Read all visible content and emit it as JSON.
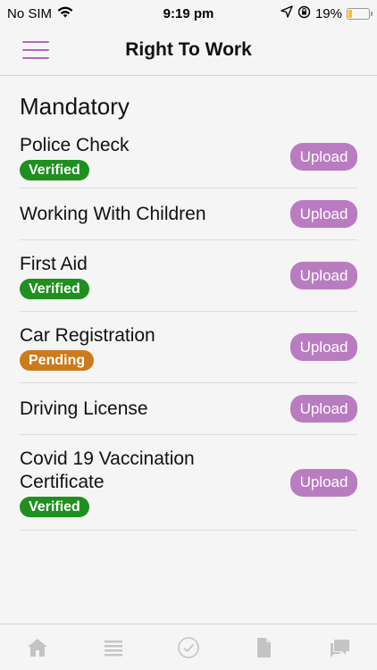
{
  "status_bar": {
    "carrier": "No SIM",
    "time": "9:19 pm",
    "battery": "19%",
    "battery_level": 0.19
  },
  "header": {
    "title": "Right To Work",
    "menu_icon": "hamburger-menu-icon"
  },
  "section": {
    "title": "Mandatory"
  },
  "documents": [
    {
      "name": "Police Check",
      "status": "Verified",
      "status_type": "verified",
      "button": "Upload"
    },
    {
      "name": "Working With Children",
      "status": "",
      "status_type": "",
      "button": "Upload"
    },
    {
      "name": "First Aid",
      "status": "Verified",
      "status_type": "verified",
      "button": "Upload"
    },
    {
      "name": "Car Registration",
      "status": "Pending",
      "status_type": "pending",
      "button": "Upload"
    },
    {
      "name": "Driving License",
      "status": "",
      "status_type": "",
      "button": "Upload"
    },
    {
      "name": "Covid 19 Vaccination Certificate",
      "status": "Verified",
      "status_type": "verified",
      "button": "Upload"
    }
  ],
  "colors": {
    "accent": "#b97cc0",
    "verified": "#1f8f1f",
    "pending": "#cc7a1c"
  },
  "tab_bar": {
    "tabs": [
      "home-icon",
      "list-icon",
      "check-circle-icon",
      "document-icon",
      "chat-icon"
    ]
  }
}
